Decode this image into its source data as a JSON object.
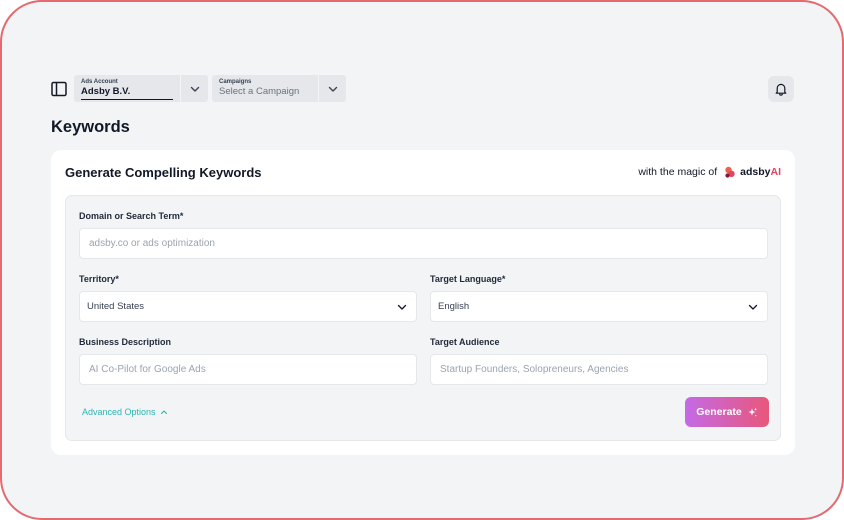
{
  "header": {
    "ads_account_label": "Ads Account",
    "ads_account_value": "Adsby B.V.",
    "campaigns_label": "Campaigns",
    "campaigns_value": "Select a Campaign"
  },
  "page": {
    "title": "Keywords"
  },
  "card": {
    "title": "Generate Compelling Keywords",
    "brand_prefix": "with the magic of",
    "brand_name": "adsby",
    "brand_ai": "AI"
  },
  "form": {
    "domain_label": "Domain or Search Term*",
    "domain_placeholder": "adsby.co or ads optimization",
    "territory_label": "Territory*",
    "territory_value": "United States",
    "language_label": "Target Language*",
    "language_value": "English",
    "business_label": "Business Description",
    "business_placeholder": "AI Co-Pilot for Google Ads",
    "audience_label": "Target Audience",
    "audience_placeholder": "Startup Founders, Solopreneurs, Agencies",
    "advanced_label": "Advanced Options",
    "generate_label": "Generate"
  },
  "colors": {
    "frame_border": "#e36a6f",
    "accent_teal": "#2bb5b0",
    "gradient_start": "#c46ae6",
    "gradient_end": "#e8577b"
  },
  "icons": [
    "sidebar-toggle-icon",
    "chevron-down-icon",
    "bell-icon",
    "adsby-logo-icon",
    "chevron-up-icon",
    "sparkle-icon"
  ]
}
